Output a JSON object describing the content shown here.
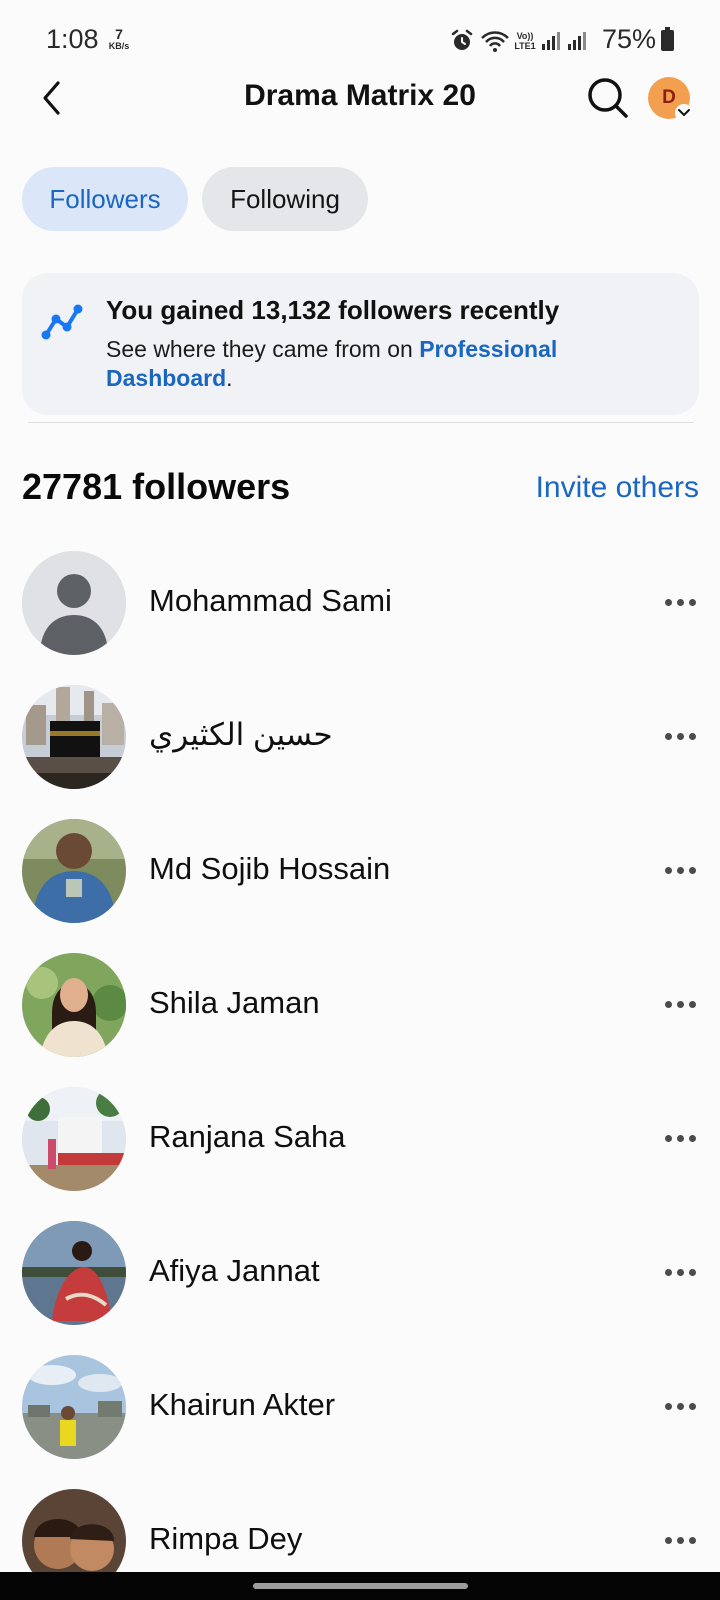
{
  "status_bar": {
    "time": "1:08",
    "net_speed_value": "7",
    "net_speed_unit": "KB/s",
    "volte_label": "Vo)) LTE1",
    "battery_percent": "75%"
  },
  "header": {
    "title": "Drama Matrix 20",
    "profile_initial": "D"
  },
  "tabs": [
    {
      "label": "Followers",
      "active": true
    },
    {
      "label": "Following",
      "active": false
    }
  ],
  "insight_card": {
    "title": "You gained 13,132 followers recently",
    "text_prefix": "See where they came from on ",
    "link_text": "Professional Dashboard",
    "text_suffix": "."
  },
  "followers_section": {
    "count_label": "27781 followers",
    "invite_label": "Invite others"
  },
  "followers": [
    {
      "name": "Mohammad Sami",
      "avatar": "default-silhouette"
    },
    {
      "name": "حسين الكثيري",
      "avatar": "kaaba-photo"
    },
    {
      "name": "Md Sojib Hossain",
      "avatar": "man-blue-jacket-photo"
    },
    {
      "name": "Shila Jaman",
      "avatar": "woman-portrait-photo"
    },
    {
      "name": "Ranjana Saha",
      "avatar": "outdoor-building-photo"
    },
    {
      "name": "Afiya Jannat",
      "avatar": "woman-red-dress-photo"
    },
    {
      "name": "Khairun Akter",
      "avatar": "child-sky-photo"
    },
    {
      "name": "Rimpa Dey",
      "avatar": "two-children-photo"
    }
  ],
  "colors": {
    "accent_blue": "#1a66c0",
    "active_tab_bg": "#dbe7f8",
    "inactive_tab_bg": "#e4e6ea",
    "card_bg": "#f0f2f5",
    "profile_badge": "#f39f50"
  }
}
